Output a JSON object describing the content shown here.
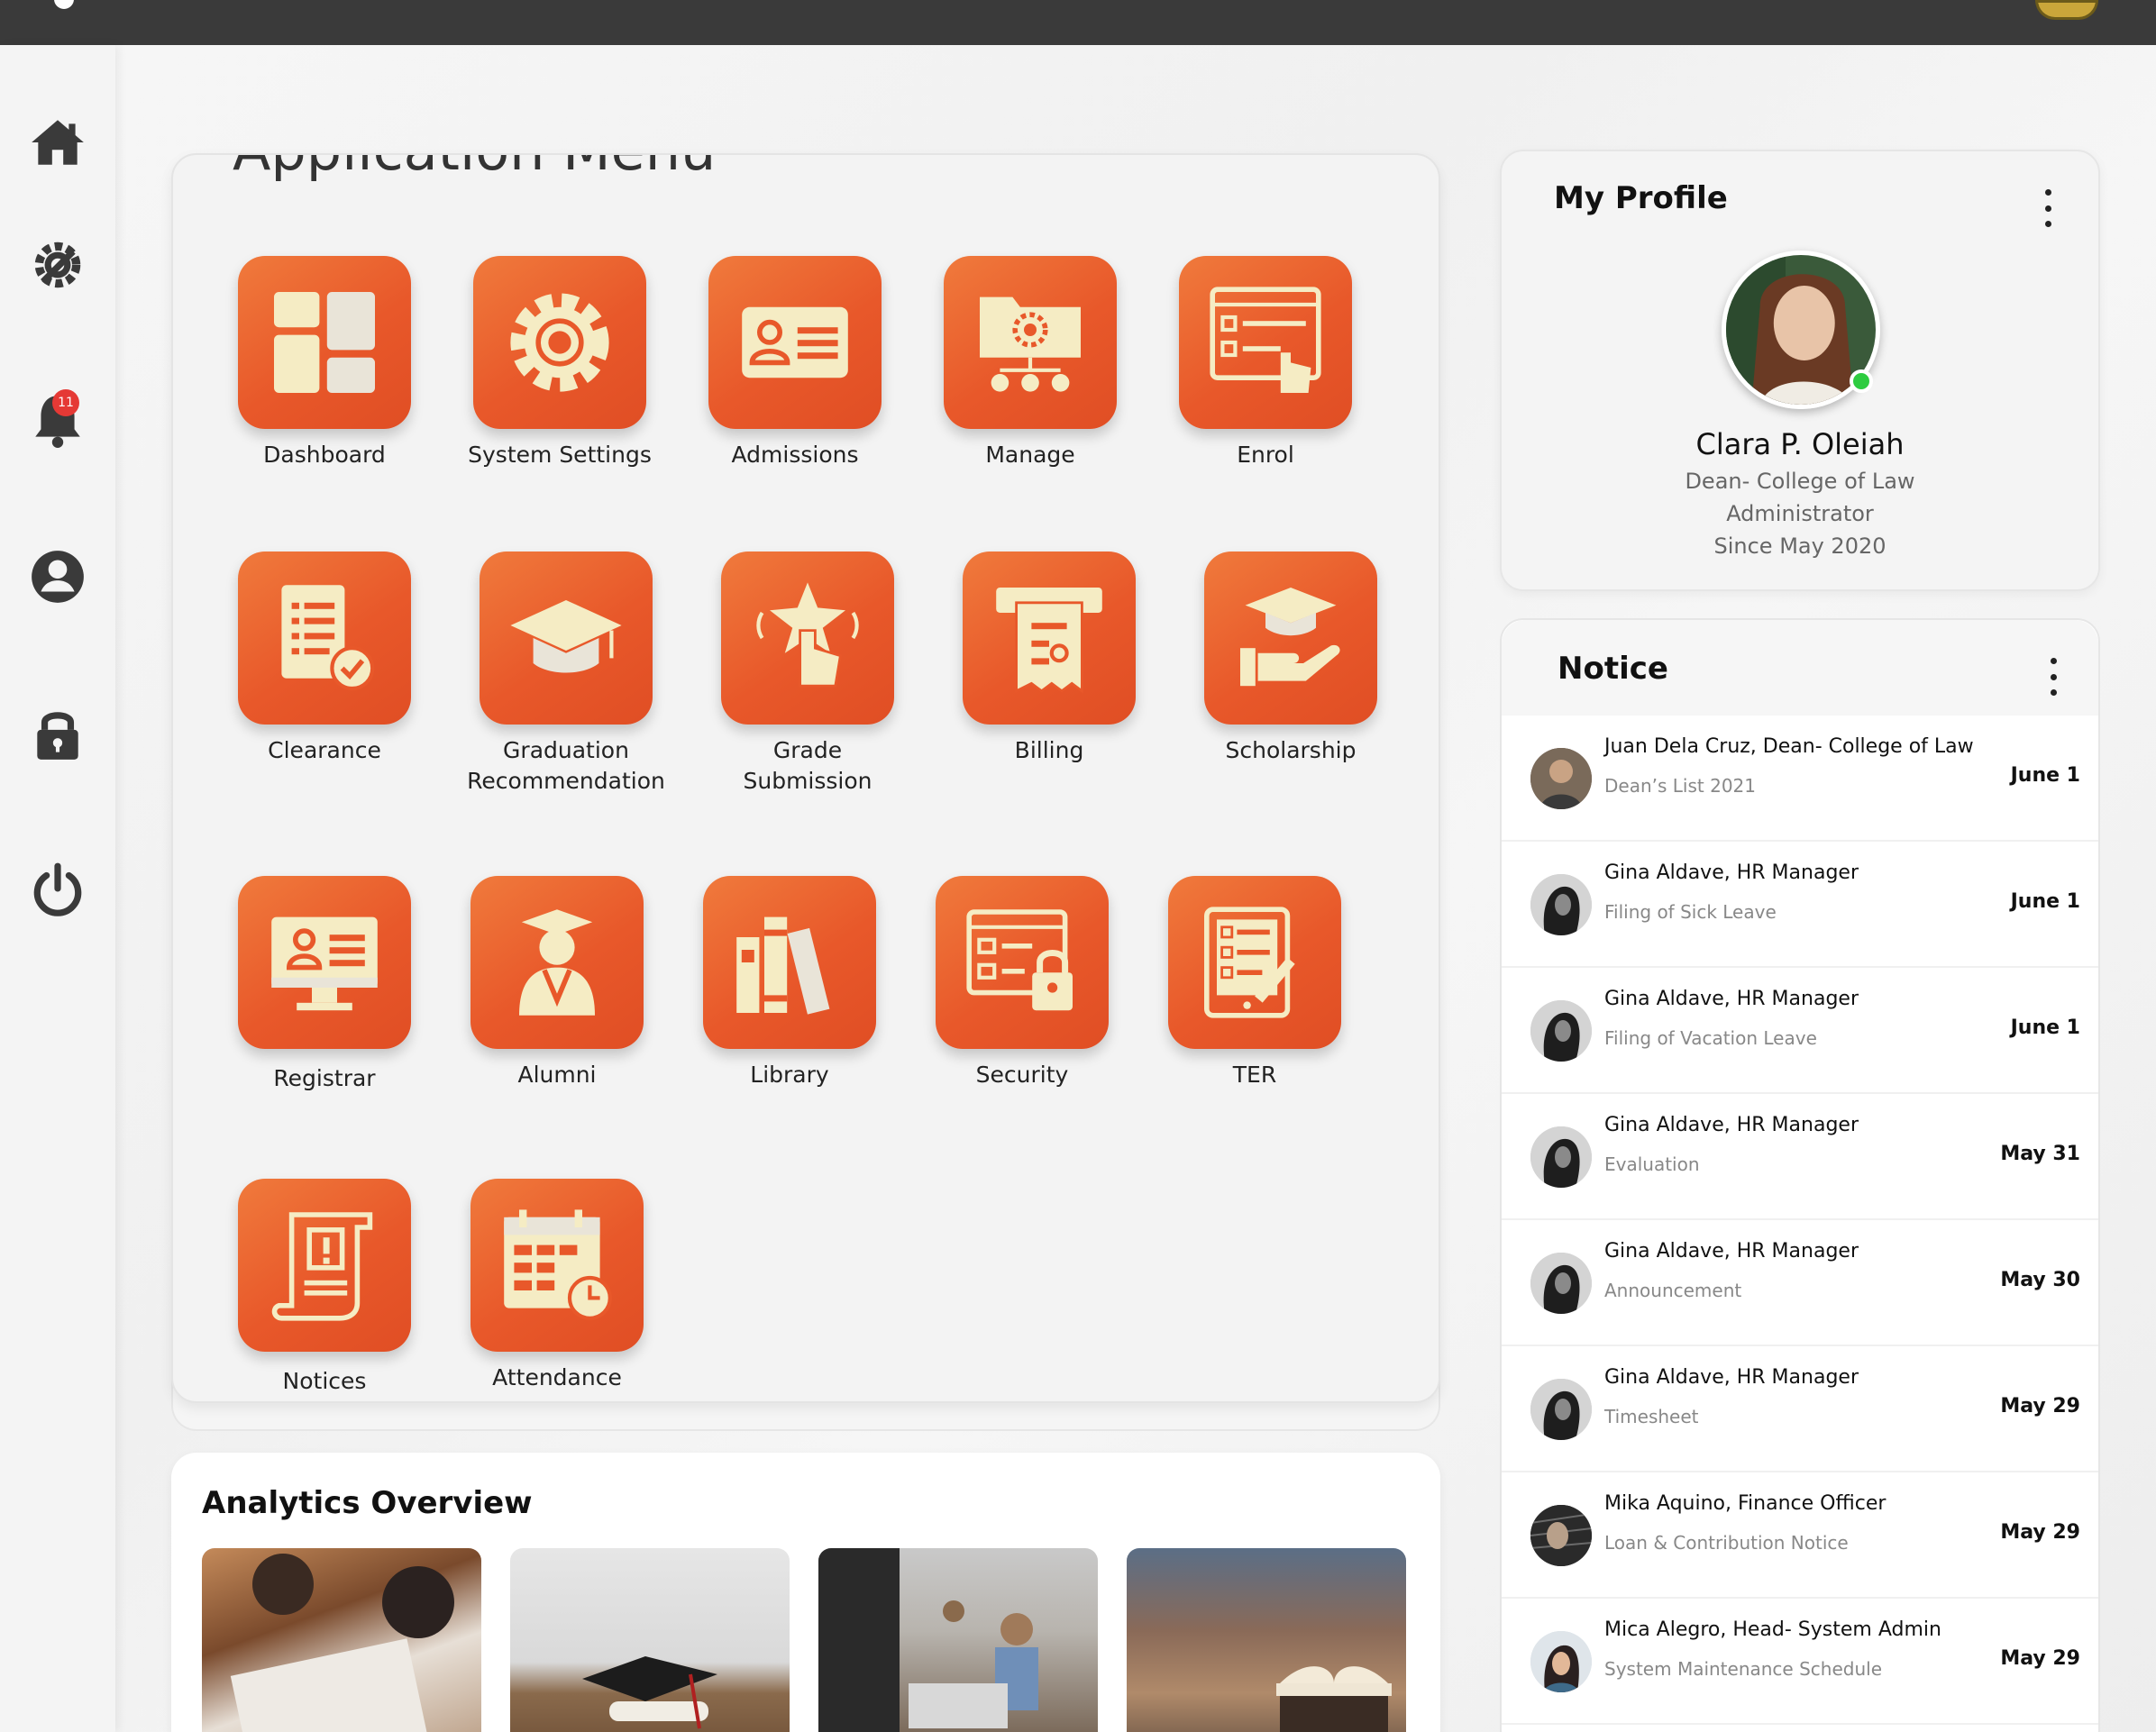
{
  "menu": {
    "title": "Application Menu",
    "apps": [
      {
        "label": "Dashboard",
        "icon": "dashboard-grid-icon"
      },
      {
        "label": "System Settings",
        "icon": "gear-icon"
      },
      {
        "label": "Admissions",
        "icon": "id-card-icon"
      },
      {
        "label": "Manage",
        "icon": "folder-gear-users-icon"
      },
      {
        "label": "Enrol",
        "icon": "checklist-pointer-icon"
      },
      {
        "label": "Clearance",
        "icon": "document-check-icon"
      },
      {
        "label": "Graduation\nRecommendation",
        "label1": "Graduation",
        "label2": "Recommendation",
        "icon": "graduation-cap-icon"
      },
      {
        "label": "Grade\nSubmission",
        "label1": "Grade",
        "label2": "Submission",
        "icon": "star-tap-icon"
      },
      {
        "label": "Billing",
        "icon": "receipt-printer-icon"
      },
      {
        "label": "Scholarship",
        "icon": "hand-cap-icon"
      },
      {
        "label": "Registrar",
        "icon": "monitor-id-icon"
      },
      {
        "label": "Alumni",
        "icon": "graduate-person-icon"
      },
      {
        "label": "Library",
        "icon": "books-icon"
      },
      {
        "label": "Security",
        "icon": "form-lock-icon"
      },
      {
        "label": "TER",
        "icon": "tablet-checklist-pen-icon"
      },
      {
        "label": "Notices",
        "icon": "scroll-notice-icon"
      },
      {
        "label": "Attendance",
        "icon": "calendar-clock-icon"
      }
    ]
  },
  "sidebar": {
    "items": [
      {
        "name": "home",
        "icon": "home-icon"
      },
      {
        "name": "settings",
        "icon": "wrench-gear-icon"
      },
      {
        "name": "notifications",
        "icon": "bell-icon",
        "badge": "11"
      },
      {
        "name": "account",
        "icon": "user-circle-icon"
      },
      {
        "name": "lock",
        "icon": "lock-icon"
      },
      {
        "name": "logout",
        "icon": "power-icon"
      }
    ]
  },
  "analytics": {
    "title": "Analytics Overview"
  },
  "profile": {
    "title": "My Profile",
    "name": "Clara P. Oleiah",
    "role": "Dean- College of Law",
    "position": "Administrator",
    "since": "Since May 2020",
    "status_color": "#2ecc40"
  },
  "notice": {
    "title": "Notice",
    "items": [
      {
        "name": "Juan Dela Cruz, Dean- College of Law",
        "subject": "Dean’s List 2021",
        "date": "June 1"
      },
      {
        "name": "Gina Aldave, HR Manager",
        "subject": "Filing of Sick Leave",
        "date": "June 1"
      },
      {
        "name": "Gina Aldave, HR Manager",
        "subject": "Filing of Vacation Leave",
        "date": "June 1"
      },
      {
        "name": "Gina Aldave, HR Manager",
        "subject": "Evaluation",
        "date": "May 31"
      },
      {
        "name": "Gina Aldave, HR Manager",
        "subject": "Announcement",
        "date": "May 30"
      },
      {
        "name": "Gina Aldave, HR Manager",
        "subject": "Timesheet",
        "date": "May 29"
      },
      {
        "name": "Mika Aquino,  Finance Officer",
        "subject": "Loan & Contribution Notice",
        "date": "May 29"
      },
      {
        "name": "Mica Alegro, Head- System Admin",
        "subject": "System Maintenance Schedule",
        "date": "May 29"
      }
    ]
  },
  "colors": {
    "accent": "#e8582a",
    "accent_light": "#f07a3c",
    "topbar": "#3a3a3a",
    "icon_fill": "#f5ecc4",
    "badge": "#e53935"
  }
}
